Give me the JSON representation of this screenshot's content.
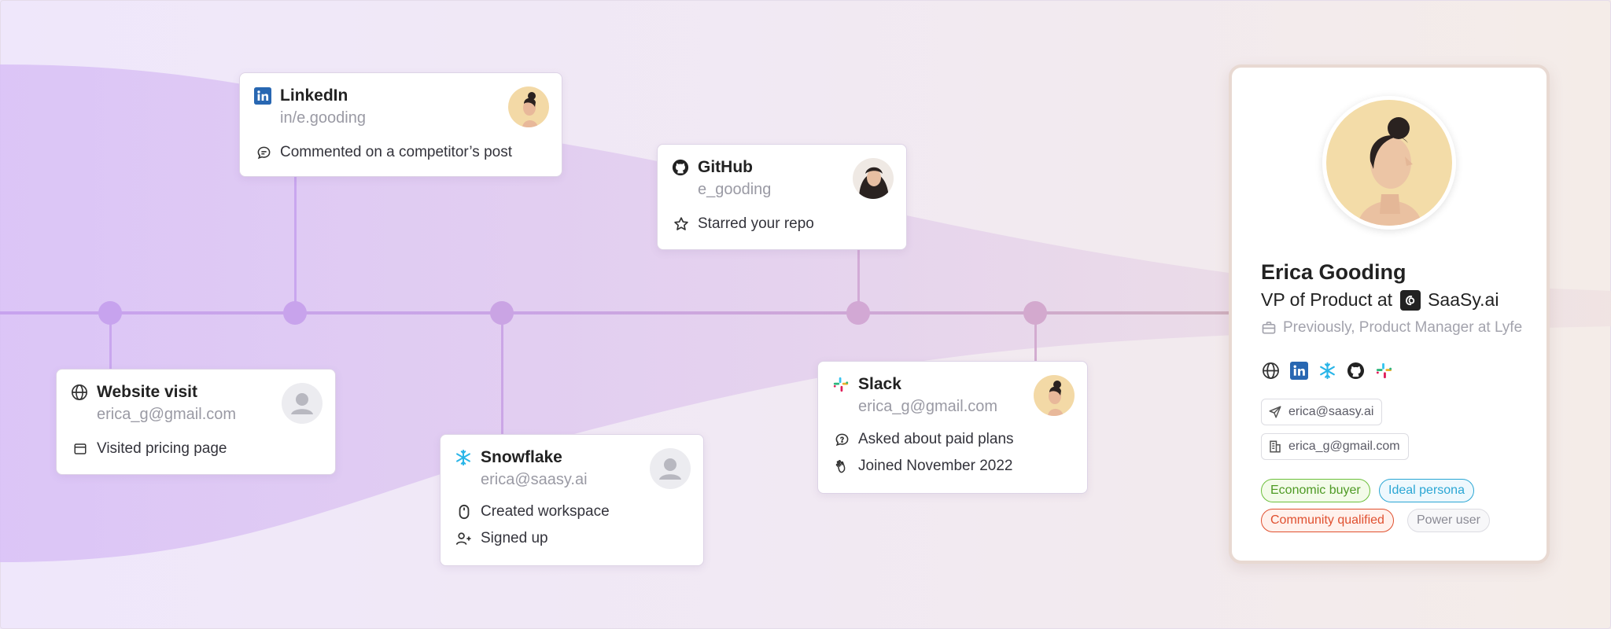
{
  "timeline_events": [
    {
      "source": "Website visit",
      "handle": "erica_g@gmail.com",
      "activities": [
        "Visited pricing page"
      ]
    },
    {
      "source": "LinkedIn",
      "handle": "in/e.gooding",
      "activities": [
        "Commented on a competitor’s post"
      ]
    },
    {
      "source": "Snowflake",
      "handle": "erica@saasy.ai",
      "activities": [
        "Created workspace",
        "Signed up"
      ]
    },
    {
      "source": "GitHub",
      "handle": "e_gooding",
      "activities": [
        "Starred your repo"
      ]
    },
    {
      "source": "Slack",
      "handle": "erica_g@gmail.com",
      "activities": [
        "Asked about paid plans",
        "Joined November 2022"
      ]
    }
  ],
  "profile": {
    "name": "Erica Gooding",
    "role_prefix": "VP of Product at",
    "company": "SaaSy.ai",
    "previous": "Previously, Product Manager at Lyfe",
    "channels": [
      "globe-icon",
      "linkedin-icon",
      "snowflake-icon",
      "github-icon",
      "slack-icon"
    ],
    "emails": [
      "erica@saasy.ai",
      "erica_g@gmail.com"
    ],
    "tags": [
      {
        "label": "Economic buyer",
        "color": "#5bab2e",
        "bg": "#f3fbe9"
      },
      {
        "label": "Ideal persona",
        "color": "#2aa6d4",
        "bg": "#eef8fd"
      },
      {
        "label": "Community qualified",
        "color": "#e0502f",
        "bg": "#fff1ec"
      },
      {
        "label": "Power user",
        "color": "#8a8a94",
        "bg": "#f7f7f9"
      }
    ]
  },
  "colors": {
    "timeline_dot_left": "#c7a3ee",
    "timeline_dot_right": "#d3a8c9",
    "linkedin": "#2867b2",
    "snowflake": "#29b5e8",
    "github": "#222222"
  }
}
